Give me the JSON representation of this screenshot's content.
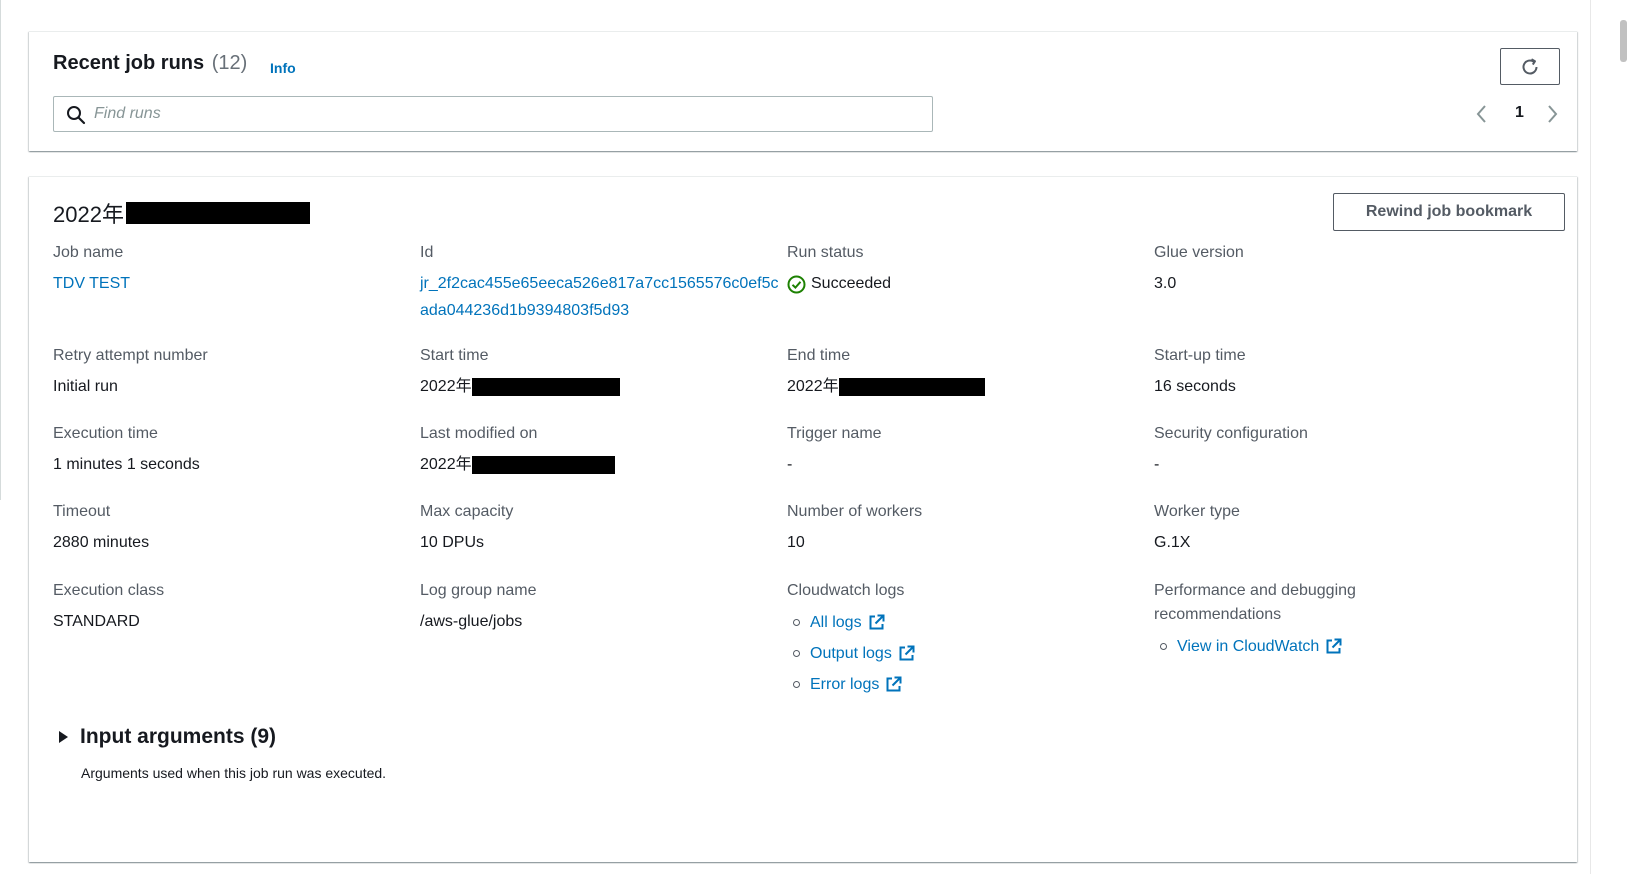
{
  "recent_runs": {
    "title": "Recent job runs",
    "count": "(12)",
    "info_label": "Info",
    "search_placeholder": "Find runs",
    "search_value": "",
    "page_number": "1"
  },
  "run": {
    "title_prefix": "2022年",
    "rewind_button_label": "Rewind job bookmark",
    "fields": {
      "job_name": {
        "label": "Job name",
        "value": "TDV TEST"
      },
      "id": {
        "label": "Id",
        "value": "jr_2f2cac455e65eeca526e817a7cc1565576c0ef5cada044236d1b9394803f5d93"
      },
      "run_status": {
        "label": "Run status",
        "value": "Succeeded"
      },
      "glue_version": {
        "label": "Glue version",
        "value": "3.0"
      },
      "retry_attempt": {
        "label": "Retry attempt number",
        "value": "Initial run"
      },
      "start_time": {
        "label": "Start time",
        "value": "2022年"
      },
      "end_time": {
        "label": "End time",
        "value": "2022年"
      },
      "startup_time": {
        "label": "Start-up time",
        "value": "16 seconds"
      },
      "execution_time": {
        "label": "Execution time",
        "value": "1 minutes 1 seconds"
      },
      "last_modified": {
        "label": "Last modified on",
        "value": "2022年"
      },
      "trigger_name": {
        "label": "Trigger name",
        "value": "-"
      },
      "security_config": {
        "label": "Security configuration",
        "value": "-"
      },
      "timeout": {
        "label": "Timeout",
        "value": "2880 minutes"
      },
      "max_capacity": {
        "label": "Max capacity",
        "value": "10 DPUs"
      },
      "num_workers": {
        "label": "Number of workers",
        "value": "10"
      },
      "worker_type": {
        "label": "Worker type",
        "value": "G.1X"
      },
      "execution_class": {
        "label": "Execution class",
        "value": "STANDARD"
      },
      "log_group": {
        "label": "Log group name",
        "value": "/aws-glue/jobs"
      },
      "cloudwatch_logs": {
        "label": "Cloudwatch logs",
        "links": [
          "All logs",
          "Output logs",
          "Error logs"
        ]
      },
      "performance": {
        "label": "Performance and debugging recommendations",
        "links": [
          "View in CloudWatch"
        ]
      }
    },
    "input_arguments": {
      "title": "Input arguments (9)",
      "description": "Arguments used when this job run was executed."
    }
  },
  "colors": {
    "link": "#0073bb",
    "success": "#1d8102",
    "text": "#16191f",
    "label": "#545b64"
  }
}
